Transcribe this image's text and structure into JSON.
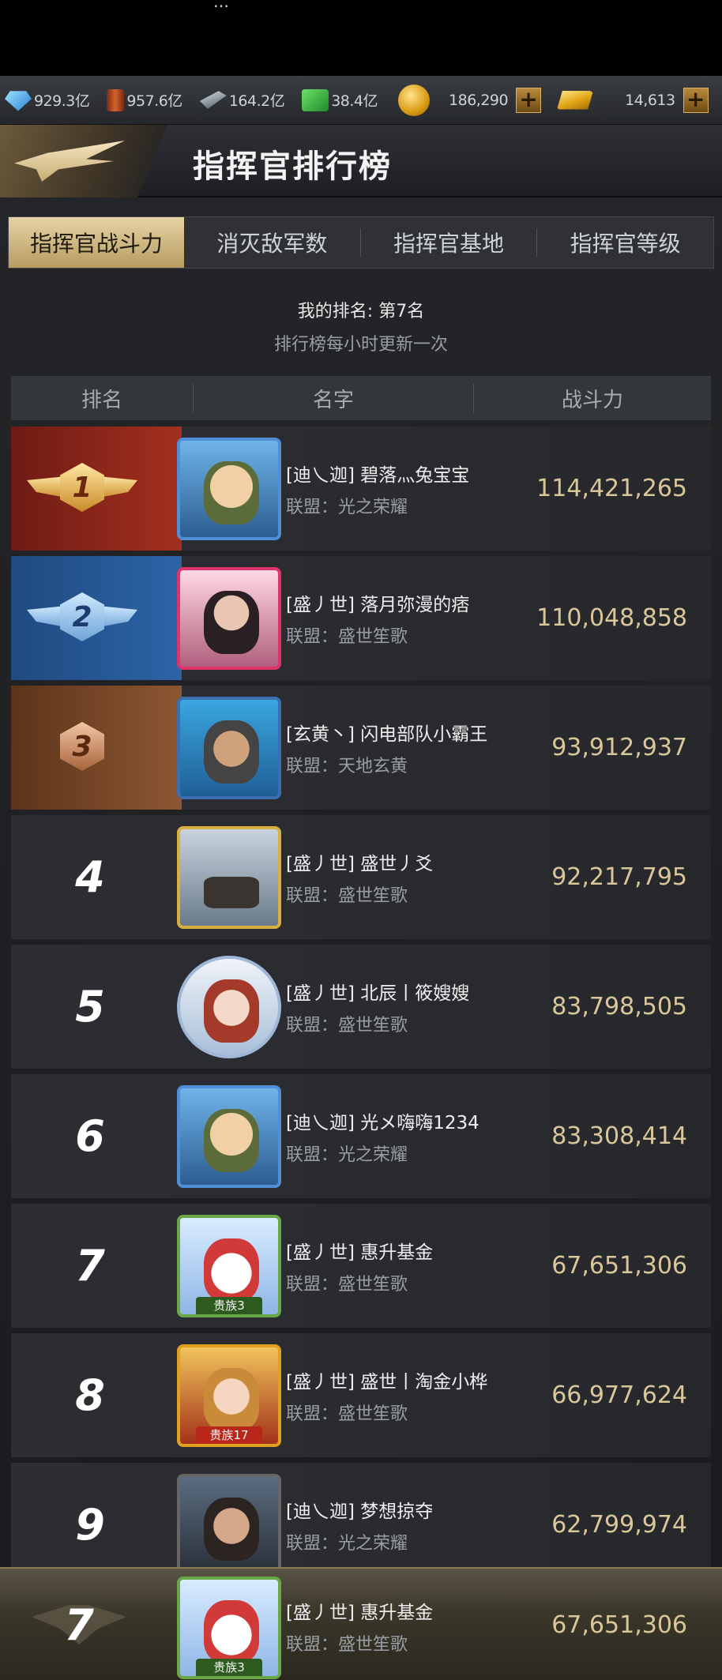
{
  "status_fragment": "…",
  "resources": [
    {
      "icon": "crystal-icon",
      "value": "929.3亿"
    },
    {
      "icon": "oil-barrel-icon",
      "value": "957.6亿"
    },
    {
      "icon": "steel-icon",
      "value": "164.2亿"
    },
    {
      "icon": "cash-icon",
      "value": "38.4亿"
    },
    {
      "icon": "coin-icon",
      "value": "186,290"
    },
    {
      "icon": "gold-bar-icon",
      "value": "14,613"
    }
  ],
  "plus_label": "+",
  "header": {
    "title": "指挥官排行榜"
  },
  "tabs": [
    "指挥官战斗力",
    "消灭敌军数",
    "指挥官基地",
    "指挥官等级"
  ],
  "my_rank_text": "我的排名: 第7名",
  "update_text": "排行榜每小时更新一次",
  "columns": [
    "排名",
    "名字",
    "战斗力"
  ],
  "rows": [
    {
      "rank": "1",
      "name": "[迪乀迦] 碧落灬兔宝宝",
      "alliance": "联盟：光之荣耀",
      "power": "114,421,265"
    },
    {
      "rank": "2",
      "name": "[盛丿世] 落月弥漫的痞",
      "alliance": "联盟：盛世笙歌",
      "power": "110,048,858"
    },
    {
      "rank": "3",
      "name": "[玄黄丶] 闪电部队小霸王",
      "alliance": "联盟：天地玄黄",
      "power": "93,912,937"
    },
    {
      "rank": "4",
      "name": "[盛丿世] 盛世丿爻",
      "alliance": "联盟：盛世笙歌",
      "power": "92,217,795"
    },
    {
      "rank": "5",
      "name": "[盛丿世] 北辰丨筱嫂嫂",
      "alliance": "联盟：盛世笙歌",
      "power": "83,798,505"
    },
    {
      "rank": "6",
      "name": "[迪乀迦] 光メ嗨嗨1234",
      "alliance": "联盟：光之荣耀",
      "power": "83,308,414"
    },
    {
      "rank": "7",
      "name": "[盛丿世] 惠升基金",
      "alliance": "联盟：盛世笙歌",
      "power": "67,651,306",
      "vip": "贵族3"
    },
    {
      "rank": "8",
      "name": "[盛丿世] 盛世丨淘金小桦",
      "alliance": "联盟：盛世笙歌",
      "power": "66,977,624",
      "vip": "贵族17"
    },
    {
      "rank": "9",
      "name": "[迪乀迦] 梦想掠夺",
      "alliance": "联盟：光之荣耀",
      "power": "62,799,974"
    }
  ],
  "my_row": {
    "rank": "7",
    "name": "[盛丿世] 惠升基金",
    "alliance": "联盟：盛世笙歌",
    "power": "67,651,306",
    "vip": "贵族3"
  }
}
